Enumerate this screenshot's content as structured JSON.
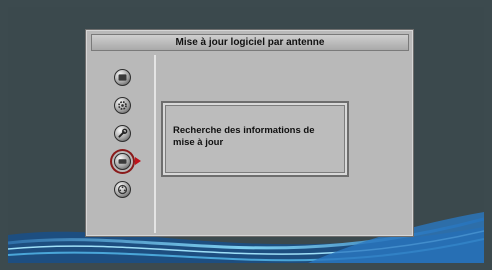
{
  "screen": {
    "title": "Mise à jour logiciel par antenne"
  },
  "menu": {
    "items": [
      {
        "icon": "tv-icon",
        "selected": false
      },
      {
        "icon": "gear-icon",
        "selected": false
      },
      {
        "icon": "wrench-icon",
        "selected": false
      },
      {
        "icon": "update-icon",
        "selected": true
      },
      {
        "icon": "film-reel-icon",
        "selected": false
      }
    ]
  },
  "message": {
    "text": "Recherche des informations de mise à jour"
  },
  "colors": {
    "background": "#3b494d",
    "panel": "#b9b9b9",
    "selection": "#8a1a1a",
    "arrow": "#c0121a"
  }
}
